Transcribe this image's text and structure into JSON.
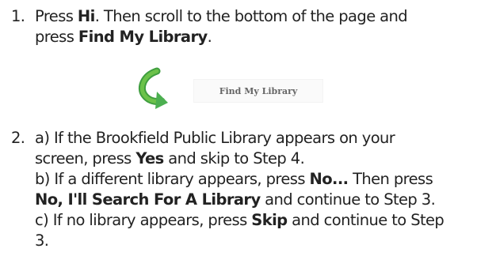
{
  "step1": {
    "number": "1.",
    "line1": {
      "a": "Press ",
      "b1": "Hi",
      "c": ". Then scroll to the bottom of the page and"
    },
    "line2": {
      "a": "press ",
      "b1": "Find My Library",
      "c": "."
    }
  },
  "button": {
    "label": "Find My Library",
    "icon": "curved-arrow-icon",
    "icon_color": "#4caf50"
  },
  "step2": {
    "number": "2.",
    "line1": "a) If the Brookfield Public Library appears on your",
    "line2": {
      "a": "screen, press ",
      "b1": "Yes",
      "c": " and skip to Step 4."
    },
    "line3": {
      "a": "b) If a different library appears, press ",
      "b1": "No...",
      "c": " Then press"
    },
    "line4": {
      "b1": "No, I'll Search For A Library",
      "c": " and continue to Step 3."
    },
    "line5": {
      "a": "c) If no library appears, press ",
      "b1": "Skip",
      "c": " and continue to Step"
    },
    "line6": "3."
  }
}
